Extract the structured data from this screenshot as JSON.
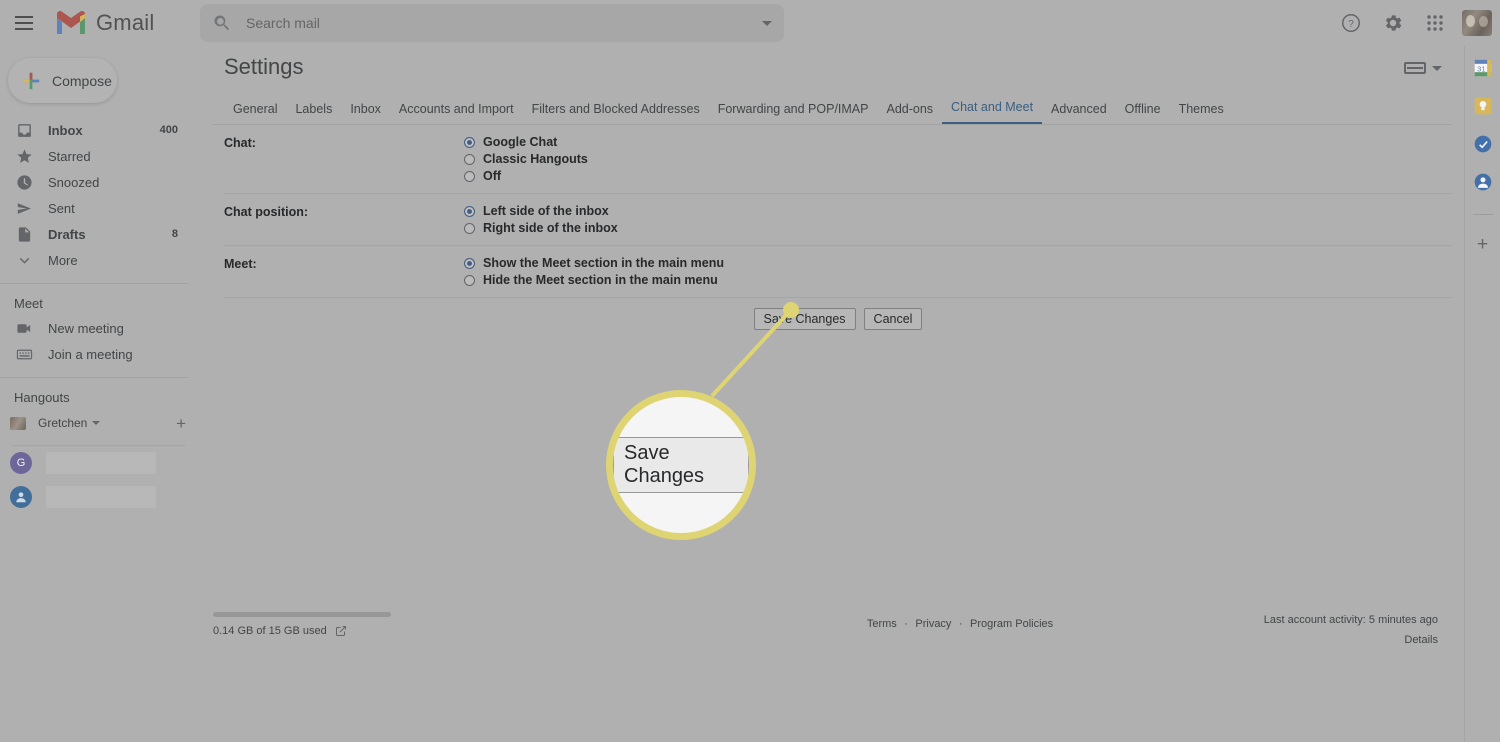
{
  "app": {
    "name": "Gmail",
    "menu_icon": "hamburger-menu-icon"
  },
  "search": {
    "placeholder": "Search mail",
    "value": "",
    "icon": "search-icon",
    "options_icon": "chevron-down-icon"
  },
  "top_right": {
    "help_icon": "help-circle-icon",
    "settings_icon": "gear-icon",
    "apps_icon": "apps-grid-icon",
    "avatar": "account-avatar"
  },
  "sidebar": {
    "compose": {
      "label": "Compose",
      "icon": "plus-icon"
    },
    "items": [
      {
        "label": "Inbox",
        "count": "400",
        "icon": "inbox-icon",
        "bold": true
      },
      {
        "label": "Starred",
        "count": "",
        "icon": "star-icon",
        "bold": false
      },
      {
        "label": "Snoozed",
        "count": "",
        "icon": "clock-icon",
        "bold": false
      },
      {
        "label": "Sent",
        "count": "",
        "icon": "send-icon",
        "bold": false
      },
      {
        "label": "Drafts",
        "count": "8",
        "icon": "document-icon",
        "bold": true
      },
      {
        "label": "More",
        "count": "",
        "icon": "chevron-down-icon",
        "bold": false
      }
    ],
    "meet": {
      "title": "Meet",
      "items": [
        {
          "label": "New meeting",
          "icon": "video-camera-icon"
        },
        {
          "label": "Join a meeting",
          "icon": "keyboard-icon"
        }
      ]
    },
    "hangouts": {
      "title": "Hangouts",
      "account_name": "Gretchen",
      "caret_icon": "chevron-down-icon",
      "add_icon": "plus-icon",
      "contacts": [
        {
          "initial": "G",
          "color": "#6b5fc4",
          "name_redacted": true
        },
        {
          "initial": "",
          "color": "#1a73c8",
          "name_redacted": true
        }
      ]
    }
  },
  "settings": {
    "title": "Settings",
    "density_icon": "display-density-icon",
    "density_caret_icon": "chevron-down-icon",
    "tabs": [
      {
        "label": "General",
        "active": false
      },
      {
        "label": "Labels",
        "active": false
      },
      {
        "label": "Inbox",
        "active": false
      },
      {
        "label": "Accounts and Import",
        "active": false
      },
      {
        "label": "Filters and Blocked Addresses",
        "active": false
      },
      {
        "label": "Forwarding and POP/IMAP",
        "active": false
      },
      {
        "label": "Add-ons",
        "active": false
      },
      {
        "label": "Chat and Meet",
        "active": true
      },
      {
        "label": "Advanced",
        "active": false
      },
      {
        "label": "Offline",
        "active": false
      },
      {
        "label": "Themes",
        "active": false
      }
    ],
    "rows": [
      {
        "label": "Chat:",
        "options": [
          {
            "label": "Google Chat",
            "selected": true
          },
          {
            "label": "Classic Hangouts",
            "selected": false
          },
          {
            "label": "Off",
            "selected": false
          }
        ]
      },
      {
        "label": "Chat position:",
        "options": [
          {
            "label": "Left side of the inbox",
            "selected": true
          },
          {
            "label": "Right side of the inbox",
            "selected": false
          }
        ]
      },
      {
        "label": "Meet:",
        "options": [
          {
            "label": "Show the Meet section in the main menu",
            "selected": true
          },
          {
            "label": "Hide the Meet section in the main menu",
            "selected": false
          }
        ]
      }
    ],
    "save_label": "Save Changes",
    "cancel_label": "Cancel"
  },
  "storage": {
    "text": "0.14 GB of 15 GB used",
    "used_percent": 1,
    "link_icon": "external-link-icon"
  },
  "footer": {
    "terms": "Terms",
    "privacy": "Privacy",
    "program_policies": "Program Policies",
    "separator": "·",
    "activity": "Last account activity: 5 minutes ago",
    "details": "Details"
  },
  "side_panel": {
    "items": [
      {
        "name": "google-calendar-icon",
        "color": "#2c7fd4",
        "label": "31"
      },
      {
        "name": "google-keep-icon",
        "color": "#f0b429",
        "label": ""
      },
      {
        "name": "google-tasks-icon",
        "color": "#2c6fd4",
        "label": ""
      },
      {
        "name": "google-contacts-icon",
        "color": "#2c6fd4",
        "label": ""
      }
    ],
    "add_icon": "plus-icon"
  },
  "annotation": {
    "magnified_label": "Save Changes",
    "highlight_color": "#f5e020"
  }
}
